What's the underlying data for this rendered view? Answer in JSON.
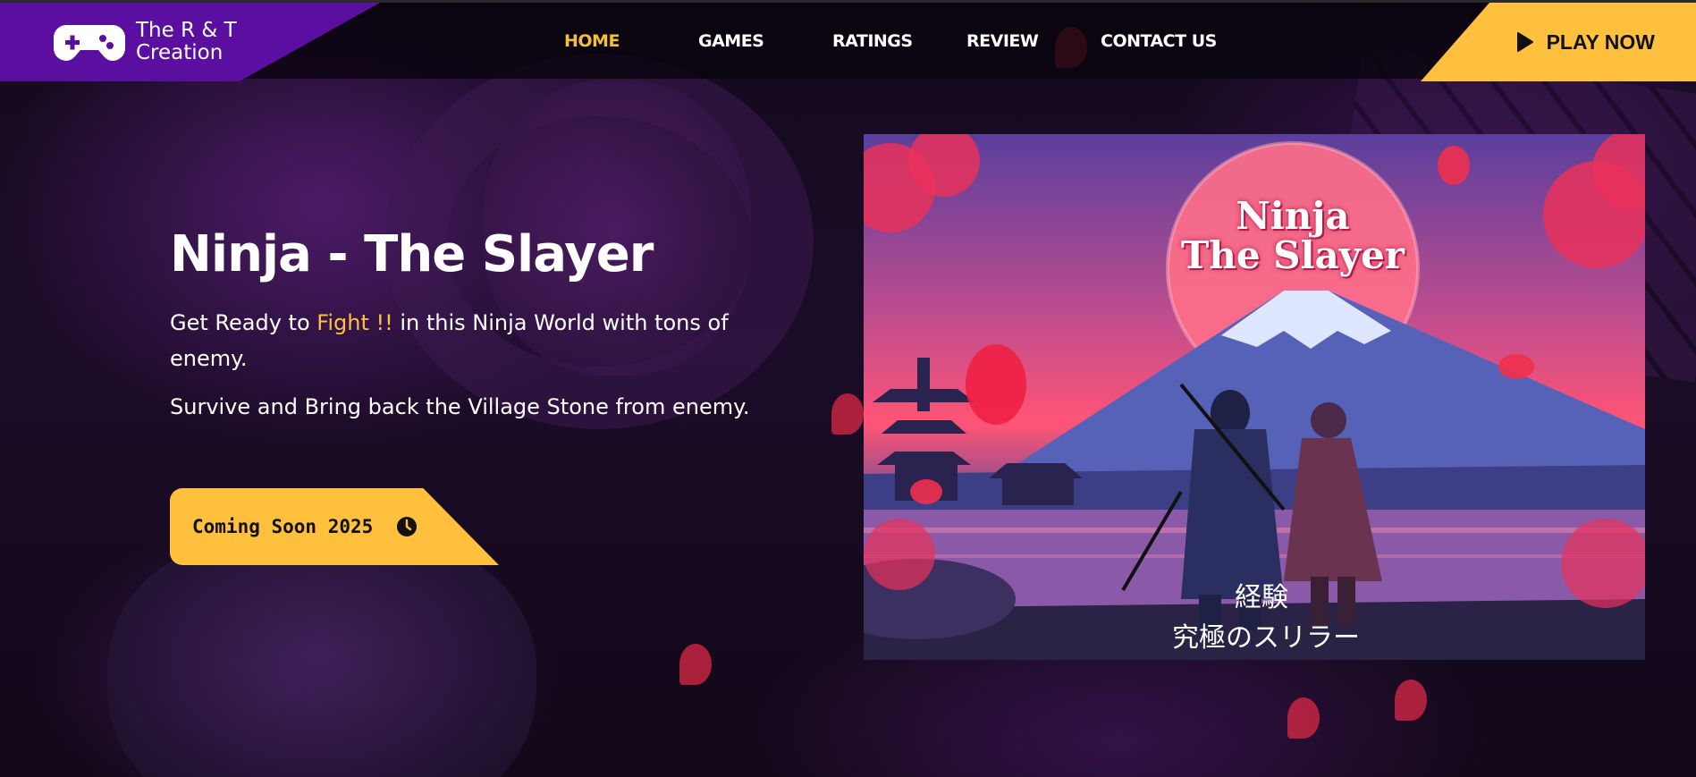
{
  "brand": {
    "name": "The R & T\nCreation",
    "icon": "gamepad-icon"
  },
  "nav": {
    "items": [
      {
        "label": "HOME",
        "active": true
      },
      {
        "label": "GAMES",
        "active": false
      },
      {
        "label": "RATINGS",
        "active": false
      },
      {
        "label": "REVIEW",
        "active": false
      },
      {
        "label": "CONTACT US",
        "active": false
      }
    ]
  },
  "header": {
    "play_label": "PLAY NOW",
    "play_icon": "play-icon"
  },
  "hero": {
    "title": "Ninja - The Slayer",
    "line1_before": "Get Ready to ",
    "line1_highlight": "Fight !!",
    "line1_after": " in this Ninja World with tons of enemy.",
    "line2": "Survive and Bring back the Village Stone from enemy.",
    "cta_label": "Coming Soon 2025",
    "cta_icon": "clock-icon"
  },
  "poster": {
    "title": "Ninja\nThe Slayer",
    "jp_line1": "経験",
    "jp_line2": "究極のスリラー"
  },
  "colors": {
    "accent": "#ffc03e",
    "brand_purple": "#5a0fa0",
    "header_bg": "#08040c"
  }
}
